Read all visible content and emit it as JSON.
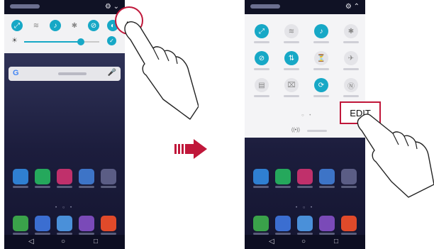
{
  "left_phone": {
    "statusbar": {
      "icons": "⚙ ⌄"
    },
    "quick_settings": {
      "tiles": [
        {
          "icon": "expand-arrows-icon",
          "glyph": "⤢",
          "on": true
        },
        {
          "icon": "wifi-icon",
          "glyph": "≋",
          "on": false
        },
        {
          "icon": "sound-icon",
          "glyph": "♪",
          "on": true
        },
        {
          "icon": "bluetooth-icon",
          "glyph": "✱",
          "on": false
        },
        {
          "icon": "do-not-disturb-icon",
          "glyph": "⊘",
          "on": true
        },
        {
          "icon": "more-tile-icon",
          "glyph": "◐",
          "on": true
        }
      ],
      "brightness": {
        "level": 0.75,
        "sun_glyph": "☀",
        "auto_glyph": "✓"
      }
    },
    "search": {
      "g": "G",
      "mic": "🎤"
    },
    "dock_rows": [
      [
        "#2f7fd1",
        "#25a85c",
        "#c0306b",
        "#3d74c7",
        "#5b5d85"
      ],
      [
        "#3aa24a",
        "#3b6ed1",
        "#4a90d9",
        "#7a4ab8",
        "#e04a2a"
      ]
    ],
    "dots": "• ○ •",
    "nav": {
      "back": "◁",
      "home": "○",
      "recent": "□"
    }
  },
  "right_phone": {
    "statusbar": {
      "icons": "⚙ ⌃"
    },
    "grid": [
      [
        {
          "g": "⤢",
          "on": true
        },
        {
          "g": "≋",
          "on": false
        },
        {
          "g": "♪",
          "on": true
        },
        {
          "g": "✱",
          "on": false
        }
      ],
      [
        {
          "g": "⊘",
          "on": true
        },
        {
          "g": "⇅",
          "on": true
        },
        {
          "g": "⏳",
          "on": false
        },
        {
          "g": "✈",
          "on": false
        }
      ],
      [
        {
          "g": "▤",
          "on": false
        },
        {
          "g": "⌧",
          "on": false
        },
        {
          "g": "⟳",
          "on": true
        },
        {
          "g": "Ⓝ",
          "on": false
        }
      ]
    ],
    "page_dots": "○ •",
    "nfc_glyph": "((•))",
    "dock_rows": [
      [
        "#2f7fd1",
        "#25a85c",
        "#c0306b",
        "#3d74c7",
        "#5b5d85"
      ],
      [
        "#3aa24a",
        "#3b6ed1",
        "#4a90d9",
        "#7a4ab8",
        "#e04a2a"
      ]
    ],
    "dots": "• ○ •",
    "nav": {
      "back": "◁",
      "home": "○",
      "recent": "□"
    }
  },
  "edit_label": "EDIT",
  "expand_glyph": "⌄",
  "colors": {
    "accent": "#17a8c6",
    "highlight": "#c0173a"
  }
}
